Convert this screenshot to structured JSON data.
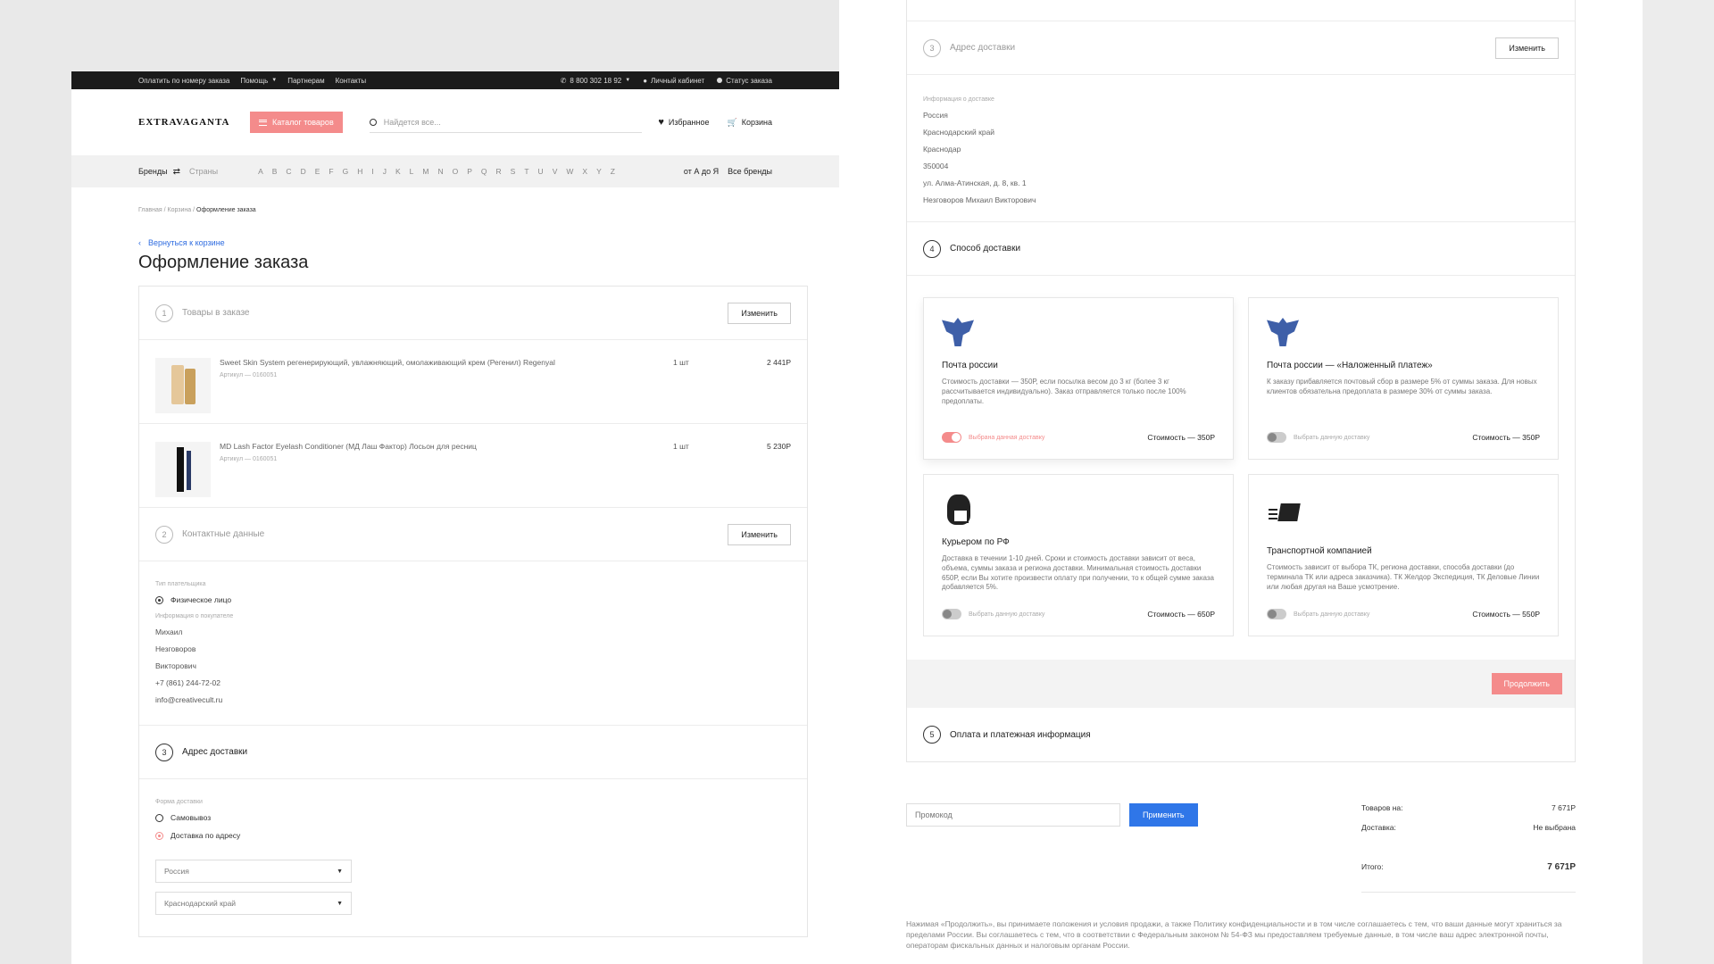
{
  "topbar": {
    "links": [
      "Оплатить по номеру заказа",
      "Помощь",
      "Партнерам",
      "Контакты"
    ],
    "phone": "8 800 302 18 92",
    "account": "Личный кабинет",
    "order_status": "Статус заказа"
  },
  "header": {
    "logo": "EXTRAVAGANTA",
    "catalog": "Каталог товаров",
    "search_placeholder": "Найдется все...",
    "favorites": "Избранное",
    "cart": "Корзина"
  },
  "brandbar": {
    "brands": "Бренды",
    "countries": "Страны",
    "letters": [
      "A",
      "B",
      "C",
      "D",
      "E",
      "F",
      "G",
      "H",
      "I",
      "J",
      "K",
      "L",
      "M",
      "N",
      "O",
      "P",
      "Q",
      "R",
      "S",
      "T",
      "U",
      "V",
      "W",
      "X",
      "Y",
      "Z"
    ],
    "az": "от А до Я",
    "all": "Все бренды"
  },
  "breadcrumbs": [
    "Главная",
    "/",
    "Корзина",
    "/",
    "Оформление заказа"
  ],
  "back": "Вернуться к корзине",
  "title": "Оформление заказа",
  "sections": {
    "s1": {
      "num": "1",
      "title": "Товары в заказе",
      "btn": "Изменить"
    },
    "s2": {
      "num": "2",
      "title": "Контактные данные",
      "btn": "Изменить"
    },
    "s3": {
      "num": "3",
      "title": "Адрес доставки",
      "btn": "Изменить"
    },
    "s4": {
      "num": "4",
      "title": "Способ доставки"
    },
    "s5": {
      "num": "5",
      "title": "Оплата и платежная информация"
    }
  },
  "items": [
    {
      "name": "Sweet Skin System регенерирующий, увлажняющий, омолаживающий крем (Регенил) Regenyal",
      "article": "Артикул — 0160051",
      "qty": "1 шт",
      "price": "2 441Р"
    },
    {
      "name": "MD Lash Factor Eyelash Conditioner (МД Лаш Фактор) Лосьон для ресниц",
      "article": "Артикул — 0160051",
      "qty": "1 шт",
      "price": "5 230Р"
    }
  ],
  "contact": {
    "payer_label": "Тип плательщика",
    "payer_type": "Физическое лицо",
    "buyer_label": "Информация о покупателе",
    "lines": [
      "Михаил",
      "Незговоров",
      "Викторович",
      "+7 (861) 244-72-02",
      "info@creativecult.ru"
    ]
  },
  "delivery_form": {
    "label": "Форма доставки",
    "opt1": "Самовывоз",
    "opt2": "Доставка по адресу",
    "country": "Россия",
    "region": "Краснодарский край"
  },
  "address": {
    "label": "Информация о доставке",
    "lines": [
      "Россия",
      "Краснодарский край",
      "Краснодар",
      "350004",
      "ул. Алма-Атинская, д. 8, кв. 1",
      "Незговоров Михаил Викторович"
    ]
  },
  "methods": [
    {
      "title": "Почта россии",
      "desc": "Стоимость доставки — 350Р, если посылка весом до 3 кг (более 3 кг рассчитывается индивидуально). Заказ отправляется только после 100% предоплаты.",
      "toggle": "Выбрана данная доставку",
      "cost": "Стоимость — 350Р",
      "icon": "russian-post-eagle-icon"
    },
    {
      "title": "Почта россии — «Наложенный платеж»",
      "desc": "К заказу прибавляется почтовый сбор в размере 5% от суммы заказа. Для новых клиентов обязательна предоплата в размере 30% от суммы заказа.",
      "toggle": "Выбрать данную доставку",
      "cost": "Стоимость — 350Р",
      "icon": "russian-post-eagle-icon"
    },
    {
      "title": "Курьером по РФ",
      "desc": "Доставка в течении 1-10 дней. Сроки и стоимость доставки зависит от веса, объема, суммы заказа и региона доставки. Минимальная стоимость доставки 650Р, если Вы хотите произвести оплату при получении, то к общей сумме заказа добавляется 5%.",
      "toggle": "Выбрать данную доставку",
      "cost": "Стоимость — 650Р",
      "icon": "courier-icon"
    },
    {
      "title": "Транспортной компанией",
      "desc": "Стоимость зависит от выбора ТК, региона доставки, способа доставки (до терминала ТК или адреса заказчика). ТК Желдор Экспедиция, ТК Деловые Линии или любая другая на Ваше усмотрение.",
      "toggle": "Выбрать данную доставку",
      "cost": "Стоимость — 550Р",
      "icon": "delivery-truck-icon"
    }
  ],
  "continue": "Продолжить",
  "promo": {
    "placeholder": "Промокод",
    "apply": "Применить"
  },
  "totals": {
    "goods_label": "Товаров на:",
    "goods": "7 671Р",
    "delivery_label": "Доставка:",
    "delivery": "Не выбрана",
    "total_label": "Итого:",
    "total": "7 671Р"
  },
  "legal": "Нажимая «Продолжить», вы принимаете положения и условия продажи, а также Политику конфиденциальности и в том числе соглашаетесь с тем, что ваши данные могут храниться за пределами России. Вы соглашаетесь с тем, что в соответствии с Федеральным законом № 54-ФЗ мы предоставляем требуемые данные, в том числе ваш адрес электронной почты, операторам фискальных данных и налоговым органам России."
}
